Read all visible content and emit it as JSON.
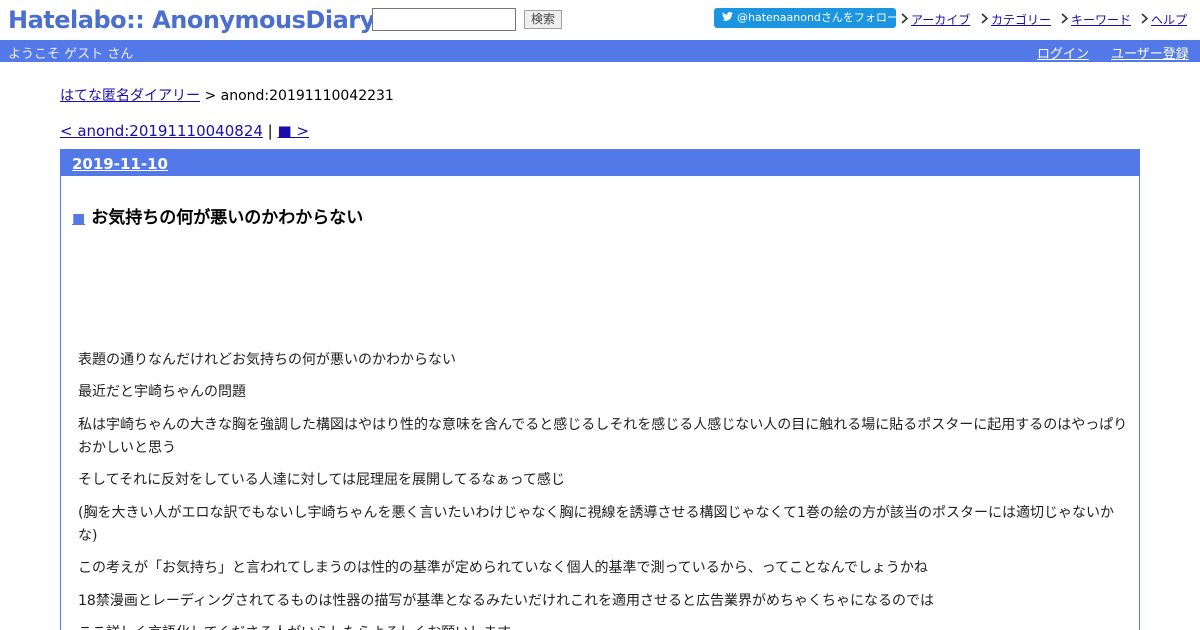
{
  "header": {
    "logo": "Hatelabo:: AnonymousDiary",
    "search_value": "",
    "search_button": "検索",
    "follow_button": "@hatenaanondさんをフォロー",
    "links": [
      "アーカイブ",
      "カテゴリー",
      "キーワード",
      "ヘルプ"
    ]
  },
  "bar": {
    "welcome": "ようこそ ゲスト さん",
    "login": "ログイン",
    "register": "ユーザー登録"
  },
  "breadcrumb": {
    "home": "はてな匿名ダイアリー",
    "separator": " > ",
    "current": "anond:20191110042231"
  },
  "nav": {
    "prev": "< anond:20191110040824",
    "divider": " | ",
    "next": "■ >"
  },
  "entry": {
    "date": "2019-11-10",
    "marker": "■",
    "title": "お気持ちの何が悪いのかわからない",
    "paragraphs": [
      "表題の通りなんだけれどお気持ちの何が悪いのかわからない",
      "最近だと宇崎ちゃんの問題",
      "私は宇崎ちゃんの大きな胸を強調した構図はやはり性的な意味を含んでると感じるしそれを感じる人感じない人の目に触れる場に貼るポスターに起用するのはやっぱりおかしいと思う",
      "そしてそれに反対をしている人達に対しては屁理屈を展開してるなぁって感じ",
      "(胸を大きい人がエロな訳でもないし宇崎ちゃんを悪く言いたいわけじゃなく胸に視線を誘導させる構図じゃなくて1巻の絵の方が該当のポスターには適切じゃないかな)",
      "この考えが「お気持ち」と言われてしまうのは性的の基準が定められていなく個人的基準で測っているから、ってことなんでしょうかね",
      "18禁漫画とレーディングされてるものは性器の描写が基準となるみたいだけれこれを適用させると広告業界がめちゃくちゃになるのでは",
      "ここ詳しく言語化してくださる人がいらしたらよろしくお願いします"
    ]
  }
}
